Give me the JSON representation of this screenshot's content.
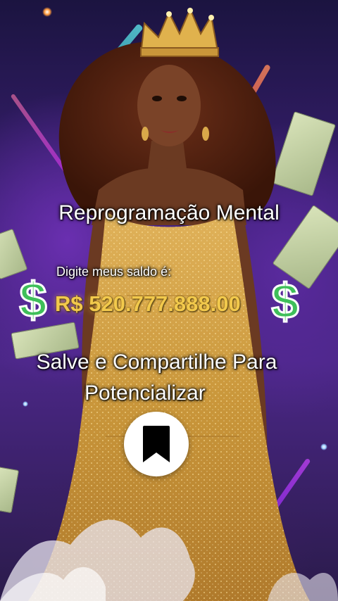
{
  "overlay": {
    "title": "Reprogramação Mental",
    "balance_label": "Digite meus saldo é:",
    "balance_value": "R$ 520.777.888.00",
    "cta_line1": "Salve e Compartilhe Para",
    "cta_line2": "Potencializar",
    "dollar_glyph": "$"
  },
  "colors": {
    "background_deep": "#1b1440",
    "background_purple": "#4b2787",
    "gold_dress": "#c9963a",
    "balance_gold": "#f2c94c",
    "dollar_green": "#3fbf5a"
  },
  "icons": [
    "crown-icon",
    "dollar-sign-icon",
    "bookmark-icon"
  ]
}
